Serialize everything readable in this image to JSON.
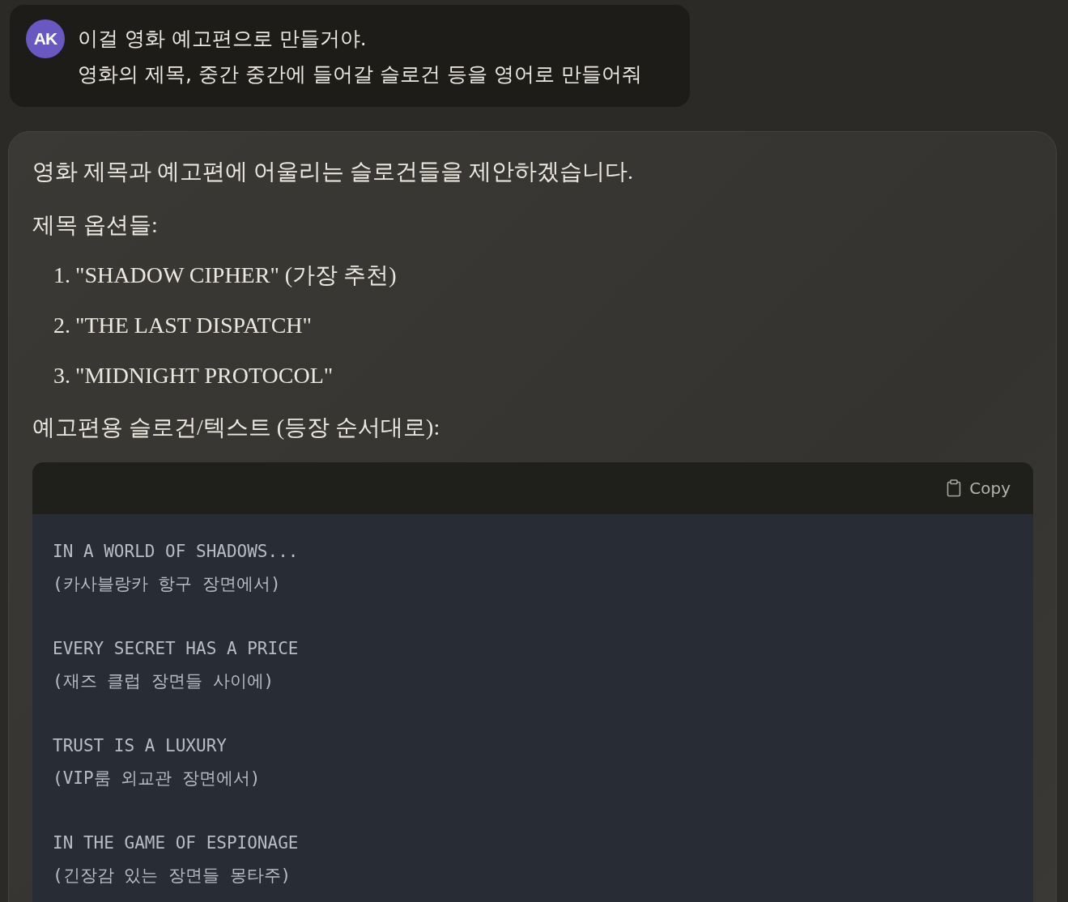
{
  "user_message": {
    "avatar": "AK",
    "lines": [
      "이걸 영화 예고편으로 만들거야.",
      "영화의 제목, 중간 중간에 들어갈 슬로건 등을 영어로 만들어줘"
    ]
  },
  "reply": {
    "intro": "영화 제목과 예고편에 어울리는 슬로건들을 제안하겠습니다.",
    "titles_heading": "제목 옵션들:",
    "titles": [
      {
        "number": "1.",
        "text": "\"SHADOW CIPHER\" (가장 추천)"
      },
      {
        "number": "2.",
        "text": "\"THE LAST DISPATCH\""
      },
      {
        "number": "3.",
        "text": "\"MIDNIGHT PROTOCOL\""
      }
    ],
    "slogans_heading": "예고편용 슬로건/텍스트 (등장 순서대로):",
    "code": {
      "copy_label": "Copy",
      "blocks": [
        [
          "IN A WORLD OF SHADOWS...",
          "(카사블랑카 항구 장면에서)"
        ],
        [
          "EVERY SECRET HAS A PRICE",
          "(재즈 클럽 장면들 사이에)"
        ],
        [
          "TRUST IS A LUXURY",
          "(VIP룸 외교관 장면에서)"
        ],
        [
          "IN THE GAME OF ESPIONAGE",
          "(긴장감 있는 장면들 몽타주)"
        ]
      ]
    }
  }
}
